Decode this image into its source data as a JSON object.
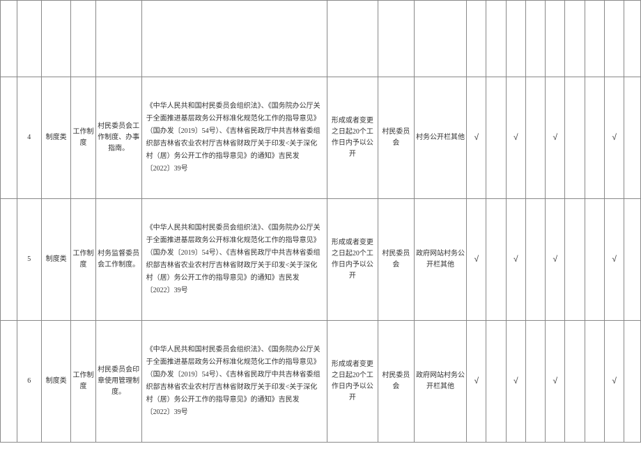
{
  "checkmark": "√",
  "rows": [
    {
      "seq": "4",
      "category": "制度类",
      "subcategory": "工作制度",
      "title": "村民委员会工作制度、办事指南。",
      "basis": "《中华人民共和国村民委员会组织法》、《国务院办公厅关于全面推进基层政务公开标准化规范化工作的指导意见》（国办发〔2019〕54号）、《吉林省民政厅中共吉林省委组织部吉林省农业农村厅吉林省财政厅关于印发<关于深化村（居）务公开工作的指导意见》的通知》吉民发〔2022〕39号",
      "time": "形成或者变更之日起20个工作日内予以公开",
      "subject": "村民委员会",
      "channel": "村务公开栏其他",
      "checks": [
        "√",
        "",
        "√",
        "",
        "√",
        "",
        "",
        "√"
      ]
    },
    {
      "seq": "5",
      "category": "制度类",
      "subcategory": "工作制度",
      "title": "村务监督委员会工作制度。",
      "basis": "《中华人民共和国村民委员会组织法》、《国务院办公厅关于全面推进基层政务公开标准化规范化工作的指导意见》（国办发〔2019〕54号）、《吉林省民政厅中共吉林省委组织部吉林省农业农村厅吉林省财政厅关于印发<关于深化村（居）务公开工作的指导意见》的通知》吉民发〔2022〕39号",
      "time": "形成或者变更之日起20个工作日内予以公开",
      "subject": "村民委员会",
      "channel": "政府网站村务公开栏其他",
      "checks": [
        "√",
        "",
        "√",
        "",
        "√",
        "",
        "",
        "√"
      ]
    },
    {
      "seq": "6",
      "category": "制度类",
      "subcategory": "工作制度",
      "title": "村民委员会印章使用管理制度。",
      "basis": "《中华人民共和国村民委员会组织法》、《国务院办公厅关于全面推进基层政务公开标准化规范化工作的指导意见》（国办发〔2019〕54号）、《吉林省民政厅中共吉林省委组织部吉林省农业农村厅吉林省财政厅关于印发<关于深化村（居）务公开工作的指导意见》的通知》吉民发〔2022〕39号",
      "time": "形成或者变更之日起20个工作日内予以公开",
      "subject": "村民委员会",
      "channel": "政府网站村务公开栏其他",
      "checks": [
        "√",
        "",
        "√",
        "",
        "√",
        "",
        "",
        "√"
      ]
    }
  ]
}
